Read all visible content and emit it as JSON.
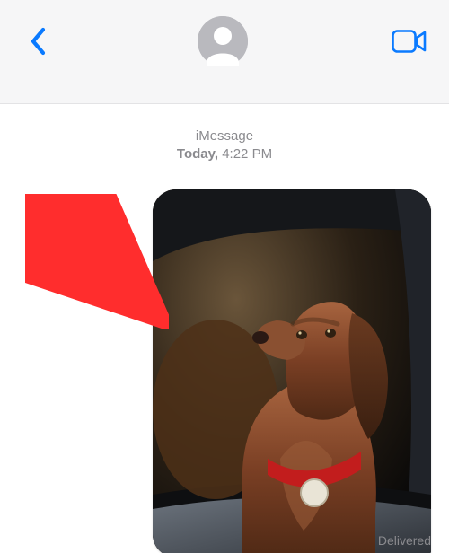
{
  "header": {
    "back_icon": "chevron-left",
    "avatar_icon": "person-circle",
    "facetime_icon": "video-camera"
  },
  "thread": {
    "service_label": "iMessage",
    "timestamp_day": "Today,",
    "timestamp_time": "4:22 PM",
    "delivered_label": "Delivered"
  },
  "message": {
    "attachment": {
      "kind": "photo",
      "description": "Brown dog with red collar and round tag looking out of an open car window",
      "dominant_colors": [
        "#3a2a1a",
        "#7a3a22",
        "#c01f1f",
        "#0e0e10"
      ]
    }
  },
  "annotation": {
    "arrow_color": "#ff2d2d",
    "arrow_description": "red arrow pointing at the photo attachment"
  }
}
